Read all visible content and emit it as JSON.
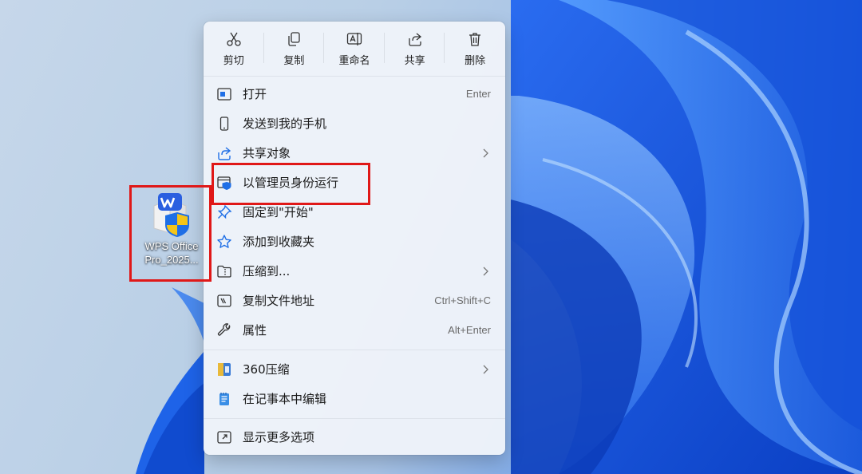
{
  "desktop": {
    "icon_label_line1": "WPS Office",
    "icon_label_line2": "Pro_2025..."
  },
  "context_menu": {
    "quick_actions": [
      {
        "label": "剪切",
        "icon": "scissors-icon"
      },
      {
        "label": "复制",
        "icon": "copy-icon"
      },
      {
        "label": "重命名",
        "icon": "rename-icon"
      },
      {
        "label": "共享",
        "icon": "share-icon"
      },
      {
        "label": "删除",
        "icon": "trash-icon"
      }
    ],
    "items": [
      {
        "label": "打开",
        "shortcut": "Enter",
        "icon": "open-window-icon"
      },
      {
        "label": "发送到我的手机",
        "icon": "phone-icon"
      },
      {
        "label": "共享对象",
        "icon": "share-icon",
        "submenu": true
      },
      {
        "label": "以管理员身份运行",
        "icon": "shield-icon"
      },
      {
        "label": "固定到\"开始\"",
        "icon": "pin-icon"
      },
      {
        "label": "添加到收藏夹",
        "icon": "star-icon"
      },
      {
        "label": "压缩到...",
        "icon": "zip-folder-icon",
        "submenu": true
      },
      {
        "label": "复制文件地址",
        "shortcut": "Ctrl+Shift+C",
        "icon": "copy-path-icon"
      },
      {
        "label": "属性",
        "shortcut": "Alt+Enter",
        "icon": "wrench-icon"
      },
      {
        "label": "360压缩",
        "icon": "360-archive-icon",
        "submenu": true
      },
      {
        "label": "在记事本中编辑",
        "icon": "notepad-icon"
      },
      {
        "label": "显示更多选项",
        "icon": "more-options-icon"
      }
    ]
  },
  "colors": {
    "highlight": "#e01818",
    "accent": "#0a66d8"
  }
}
